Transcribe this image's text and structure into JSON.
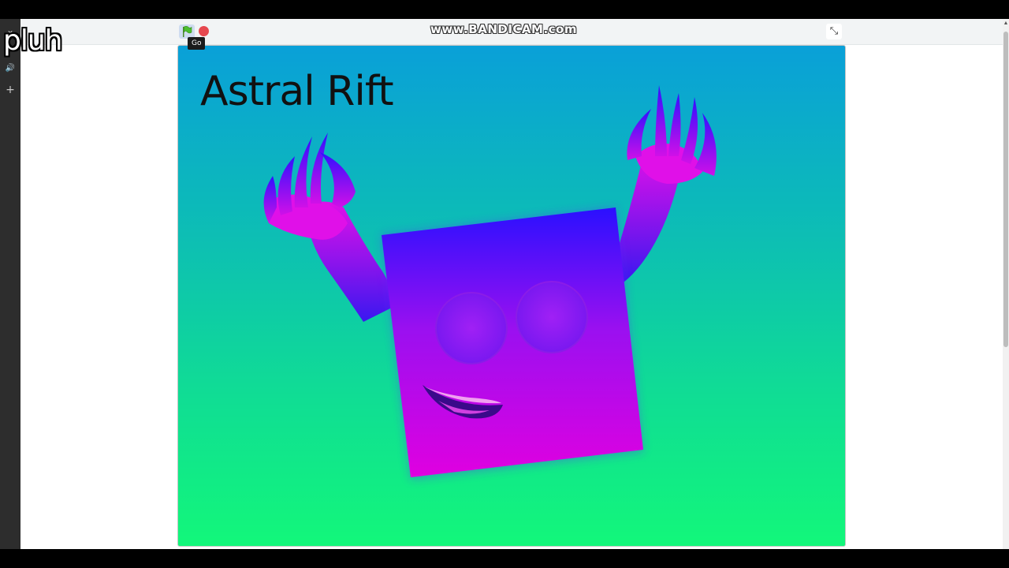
{
  "overlay": {
    "caption": "pluh"
  },
  "recorder": {
    "watermark": "www.BANDICAM.com"
  },
  "player": {
    "tooltip": "Go",
    "fullscreen_glyph": "⤡",
    "icons": {
      "flag": "green-flag-icon",
      "stop": "stop-icon",
      "fullscreen": "exit-fullscreen-icon"
    }
  },
  "sidebar": {
    "icons": [
      "chevron-down-icon",
      "speaker-icon",
      "plus-icon"
    ],
    "glyphs": {
      "chevron": "⌄",
      "speaker": "🔊",
      "plus": "+"
    }
  },
  "stage": {
    "title": "Astral Rift",
    "colors": {
      "bg_top": "#0aa0d8",
      "bg_bottom": "#12f77a",
      "creature_top": "#2a10ff",
      "creature_bottom": "#e000e0"
    }
  }
}
